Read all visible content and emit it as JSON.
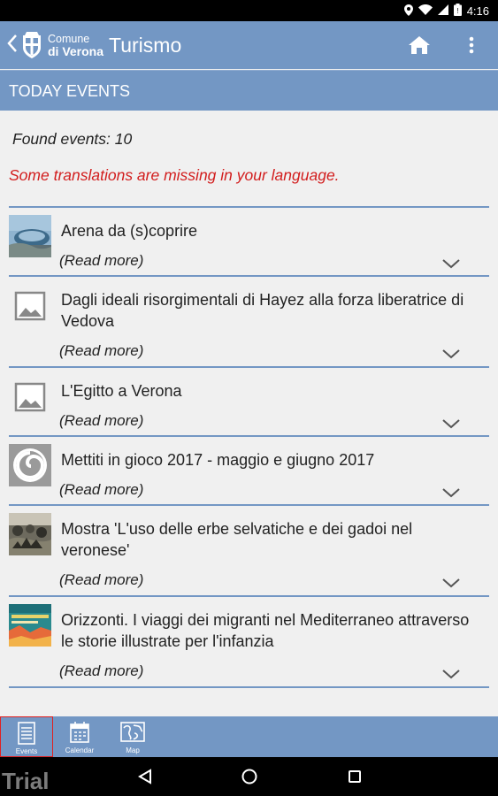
{
  "status_bar": {
    "time": "4:16",
    "icons": [
      "location-icon",
      "wifi-icon",
      "signal-icon",
      "battery-icon"
    ]
  },
  "app_bar": {
    "logo_line1": "Comune",
    "logo_line2": "di Verona",
    "title": "Turismo",
    "icons": [
      "back-chevron-icon",
      "home-icon",
      "overflow-menu-icon"
    ]
  },
  "section": {
    "title": "TODAY EVENTS"
  },
  "found_text": "Found events: 10",
  "warning_text": "Some translations are missing in your language.",
  "events": [
    {
      "title": "Arena da (s)coprire",
      "read_more": "(Read more)",
      "thumb": "arena-photo"
    },
    {
      "title": "Dagli ideali risorgimentali di Hayez alla forza liberatrice di Vedova",
      "read_more": "(Read more)",
      "thumb": "image-placeholder-icon"
    },
    {
      "title": "L'Egitto a Verona",
      "read_more": "(Read more)",
      "thumb": "image-placeholder-icon"
    },
    {
      "title": "Mettiti in gioco 2017 - maggio e giugno 2017",
      "read_more": "(Read more)",
      "thumb": "spiral-logo"
    },
    {
      "title": "Mostra 'L'uso delle erbe selvatiche e dei gadoi nel veronese'",
      "read_more": "(Read more)",
      "thumb": "herbs-photo"
    },
    {
      "title": "Orizzonti. I viaggi dei migranti nel Mediterraneo attraverso le storie illustrate per l'infanzia",
      "read_more": "(Read more)",
      "thumb": "orizzonti-poster"
    }
  ],
  "bottom_nav": {
    "tabs": [
      {
        "label": "Events",
        "icon": "list-icon",
        "selected": true
      },
      {
        "label": "Calendar",
        "icon": "calendar-icon",
        "selected": false
      },
      {
        "label": "Map",
        "icon": "map-icon",
        "selected": false
      }
    ]
  },
  "nav_bar": {
    "watermark": "Trial",
    "icons": [
      "back-triangle-icon",
      "home-circle-icon",
      "recents-square-icon"
    ]
  },
  "colors": {
    "primary": "#7397c4",
    "warning": "#d21d1d",
    "background": "#f0f0f0"
  }
}
